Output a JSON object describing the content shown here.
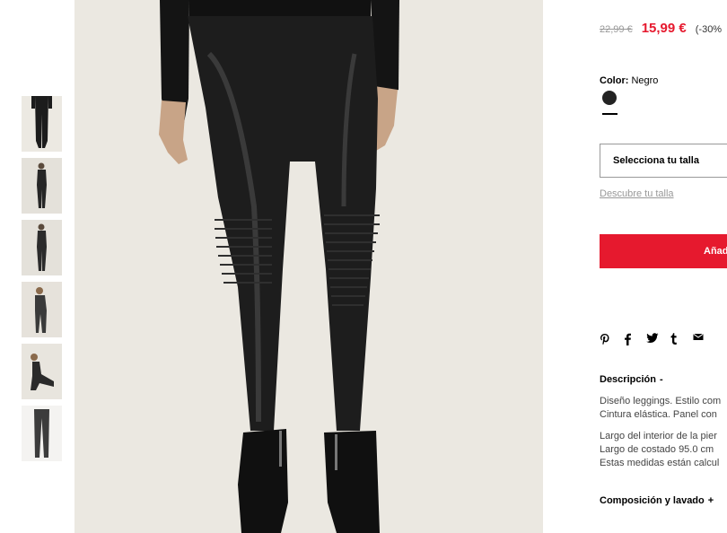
{
  "product": {
    "old_price": "22,99 €",
    "new_price": "15,99 €",
    "discount": "(-30%",
    "color_label": "Color:",
    "color_value": "Negro",
    "size_select": "Selecciona tu talla",
    "size_guide": "Descubre tu talla",
    "add_button": "Añad"
  },
  "description": {
    "title": "Descripción",
    "toggle": "-",
    "lines_a": [
      "Diseño leggings. Estilo com",
      "Cintura elástica. Panel con"
    ],
    "lines_b": [
      "Largo del interior de la pier",
      "Largo de costado 95.0 cm",
      "Estas medidas están calcul"
    ]
  },
  "composition": {
    "title": "Composición y lavado",
    "toggle": "+"
  },
  "share_icons": [
    "pinterest-icon",
    "facebook-icon",
    "twitter-icon",
    "tumblr-icon",
    "mail-icon"
  ],
  "colors": {
    "sale_red": "#e6192e",
    "swatch_black": "#232323",
    "image_background": "#ebe8e1"
  }
}
